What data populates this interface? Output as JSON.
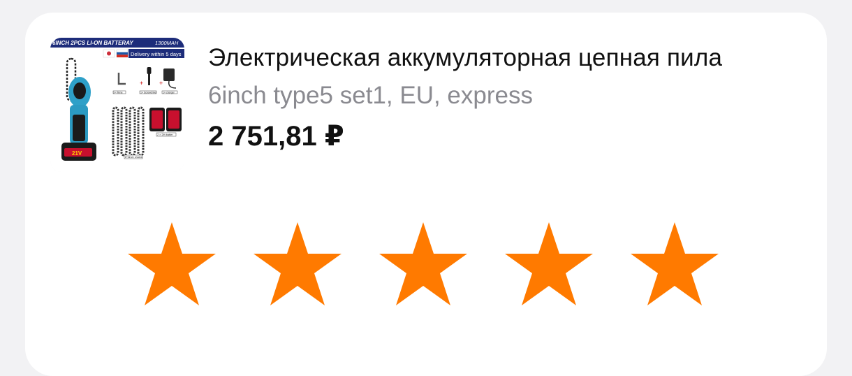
{
  "product": {
    "title": "Электрическая аккумуляторная цепная пила",
    "variant": "6inch type5 set1, EU, express",
    "price": "2 751,81 ₽",
    "image": {
      "banner_text": "6INCH 2PCS LI-ON BATTERAY",
      "capacity_text": "1300MAH",
      "delivery_text": "Delivery within 5 days",
      "wrench_label": "1× Ifinne",
      "screwdriver_label": "1× Screwdriver",
      "charger_label": "1× charger",
      "batteries_label": "2 × 2th batter",
      "chains_label": "6*6inch chains",
      "saw_badge": "21V"
    }
  },
  "rating": {
    "stars": 5,
    "color": "#ff7a00"
  }
}
